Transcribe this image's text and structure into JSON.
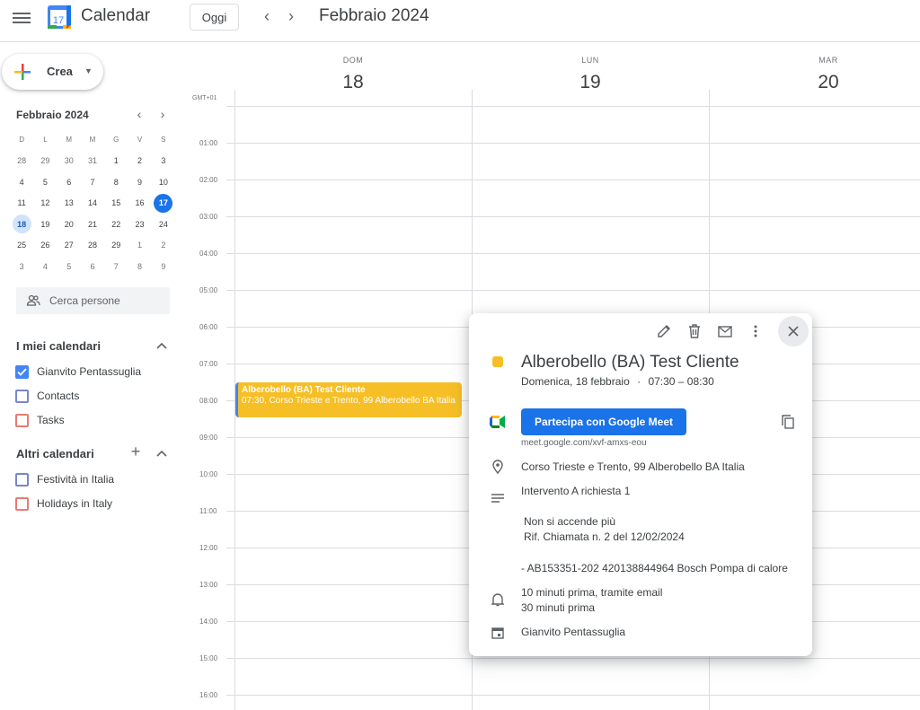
{
  "header": {
    "app_title": "Calendar",
    "logo_day": "17",
    "today_label": "Oggi",
    "month_label": "Febbraio 2024"
  },
  "sidebar": {
    "create_label": "Crea",
    "mini_calendar": {
      "title": "Febbraio 2024",
      "weekdays": [
        "D",
        "L",
        "M",
        "M",
        "G",
        "V",
        "S"
      ],
      "weeks": [
        [
          "28",
          "29",
          "30",
          "31",
          "1",
          "2",
          "3"
        ],
        [
          "4",
          "5",
          "6",
          "7",
          "8",
          "9",
          "10"
        ],
        [
          "11",
          "12",
          "13",
          "14",
          "15",
          "16",
          "17"
        ],
        [
          "18",
          "19",
          "20",
          "21",
          "22",
          "23",
          "24"
        ],
        [
          "25",
          "26",
          "27",
          "28",
          "29",
          "1",
          "2"
        ],
        [
          "3",
          "4",
          "5",
          "6",
          "7",
          "8",
          "9"
        ]
      ],
      "today": "17",
      "selected": "18"
    },
    "search_people_placeholder": "Cerca persone",
    "my_calendars": {
      "title": "I miei calendari",
      "items": [
        {
          "label": "Gianvito Pentassuglia",
          "color": "#4285f4",
          "checked": true
        },
        {
          "label": "Contacts",
          "color": "#7986cb",
          "checked": false
        },
        {
          "label": "Tasks",
          "color": "#e67c73",
          "checked": false
        }
      ]
    },
    "other_calendars": {
      "title": "Altri calendari",
      "items": [
        {
          "label": "Festività in Italia",
          "color": "#7986cb",
          "checked": false
        },
        {
          "label": "Holidays in Italy",
          "color": "#e67c73",
          "checked": false
        }
      ]
    }
  },
  "grid": {
    "timezone": "GMT+01",
    "days": [
      {
        "name": "DOM",
        "num": "18"
      },
      {
        "name": "LUN",
        "num": "19"
      },
      {
        "name": "MAR",
        "num": "20"
      }
    ],
    "hours": [
      "01:00",
      "02:00",
      "03:00",
      "04:00",
      "05:00",
      "06:00",
      "07:00",
      "08:00",
      "09:00",
      "10:00",
      "11:00",
      "12:00",
      "13:00",
      "14:00",
      "15:00",
      "16:00"
    ]
  },
  "event": {
    "title": "Alberobello (BA) Test Cliente",
    "subtitle": "07:30, Corso Trieste e Trento, 99 Alberobello BA Italia",
    "color": "#f6bf26"
  },
  "popover": {
    "title": "Alberobello (BA) Test Cliente",
    "date": "Domenica, 18 febbraio",
    "separator": "·",
    "time": "07:30 – 08:30",
    "meet_button": "Partecipa con Google Meet",
    "meet_link": "meet.google.com/xvf-amxs-eou",
    "location": "Corso Trieste e Trento, 99 Alberobello BA Italia",
    "description": {
      "line1": "Intervento A richiesta 1",
      "line2": "Non si accende più",
      "line3": "Rif. Chiamata n. 2 del 12/02/2024",
      "line4": "- AB153351-202 420138844964 Bosch Pompa di calore"
    },
    "reminders": [
      "10 minuti prima, tramite email",
      "30 minuti prima"
    ],
    "calendar_owner": "Gianvito Pentassuglia"
  }
}
